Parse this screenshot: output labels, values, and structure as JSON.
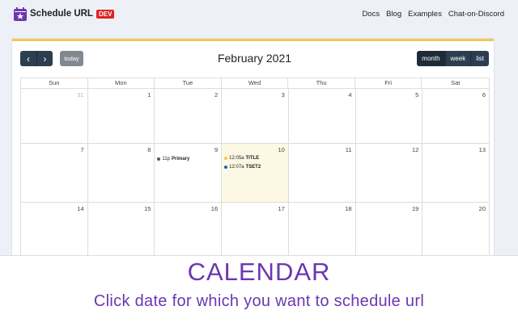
{
  "app": {
    "brand": "Schedule URL",
    "badge": "DEV"
  },
  "nav": {
    "links": [
      "Docs",
      "Blog",
      "Examples",
      "Chat-on-Discord"
    ]
  },
  "toolbar": {
    "title": "February 2021",
    "prev": "‹",
    "next": "›",
    "today": "today",
    "views": [
      "month",
      "week",
      "list"
    ]
  },
  "calendar": {
    "day_names": [
      "Sun",
      "Mon",
      "Tue",
      "Wed",
      "Thu",
      "Fri",
      "Sat"
    ],
    "weeks": [
      [
        "31",
        "1",
        "2",
        "3",
        "4",
        "5",
        "6"
      ],
      [
        "7",
        "8",
        "9",
        "10",
        "11",
        "12",
        "13"
      ],
      [
        "14",
        "15",
        "16",
        "17",
        "18",
        "19",
        "20"
      ]
    ],
    "events": [
      {
        "time": "11p",
        "title": "Primary",
        "color": "#555555"
      },
      {
        "time": "12:05a",
        "title": "TITLE",
        "color": "#f2c94c"
      },
      {
        "time": "12:07a",
        "title": "TSET2",
        "color": "#1a5fb4"
      }
    ]
  },
  "overlay": {
    "title": "CALENDAR",
    "subtitle": "Click date for which you want to schedule url"
  },
  "colors": {
    "accent": "#6a38b0",
    "toolbar": "#2c3e50",
    "today_bg": "#fcf8e3",
    "dev": "#e02020"
  }
}
